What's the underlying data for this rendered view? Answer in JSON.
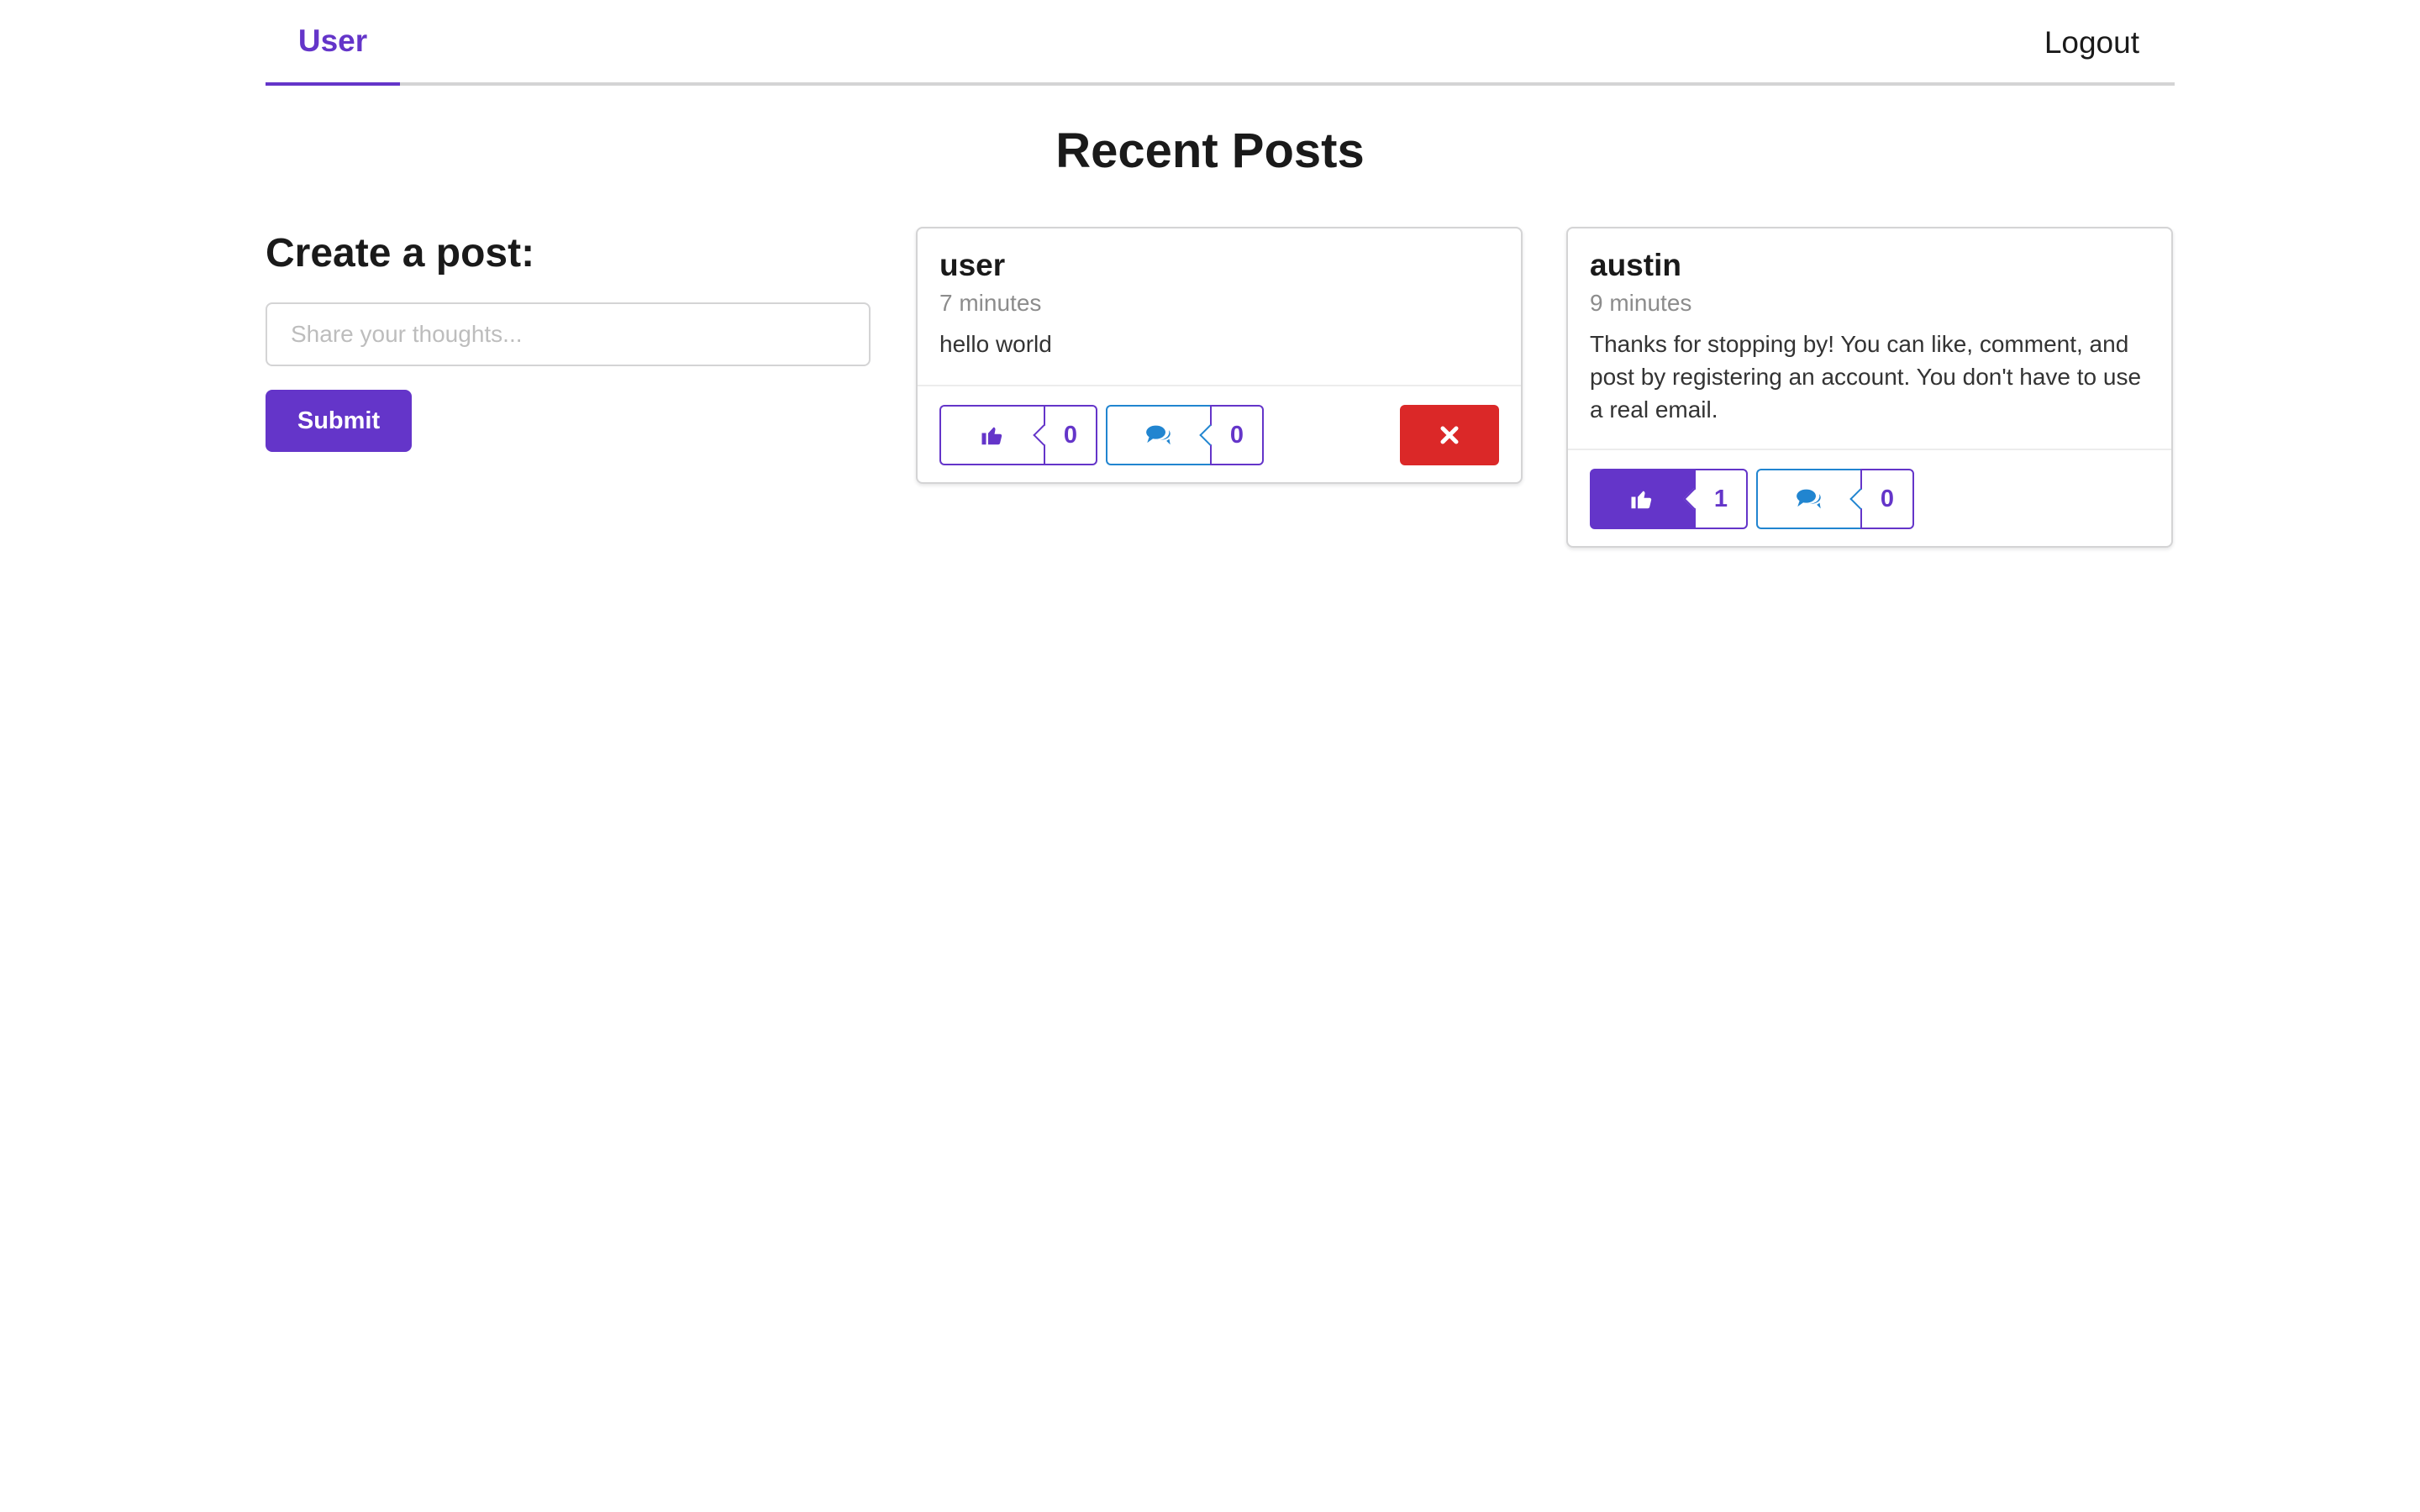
{
  "nav": {
    "active_tab": "User",
    "logout_label": "Logout"
  },
  "page": {
    "title": "Recent Posts"
  },
  "create_post": {
    "heading": "Create a post:",
    "input_placeholder": "Share your thoughts...",
    "input_value": "",
    "submit_label": "Submit"
  },
  "posts": [
    {
      "author": "user",
      "time": "7 minutes",
      "body": "hello world",
      "like_count": "0",
      "comment_count": "0",
      "liked": false,
      "deletable": true
    },
    {
      "author": "austin",
      "time": "9 minutes",
      "body": "Thanks for stopping by! You can like, comment, and post by registering an account. You don't have to use a real email.",
      "like_count": "1",
      "comment_count": "0",
      "liked": true,
      "deletable": false
    }
  ],
  "colors": {
    "accent": "#6435c9",
    "comment": "#2185d0",
    "delete": "#db2828",
    "border": "#d4d4d5"
  },
  "icons": {
    "like": "thumbs-up-icon",
    "comment": "comments-icon",
    "delete": "close-icon"
  }
}
